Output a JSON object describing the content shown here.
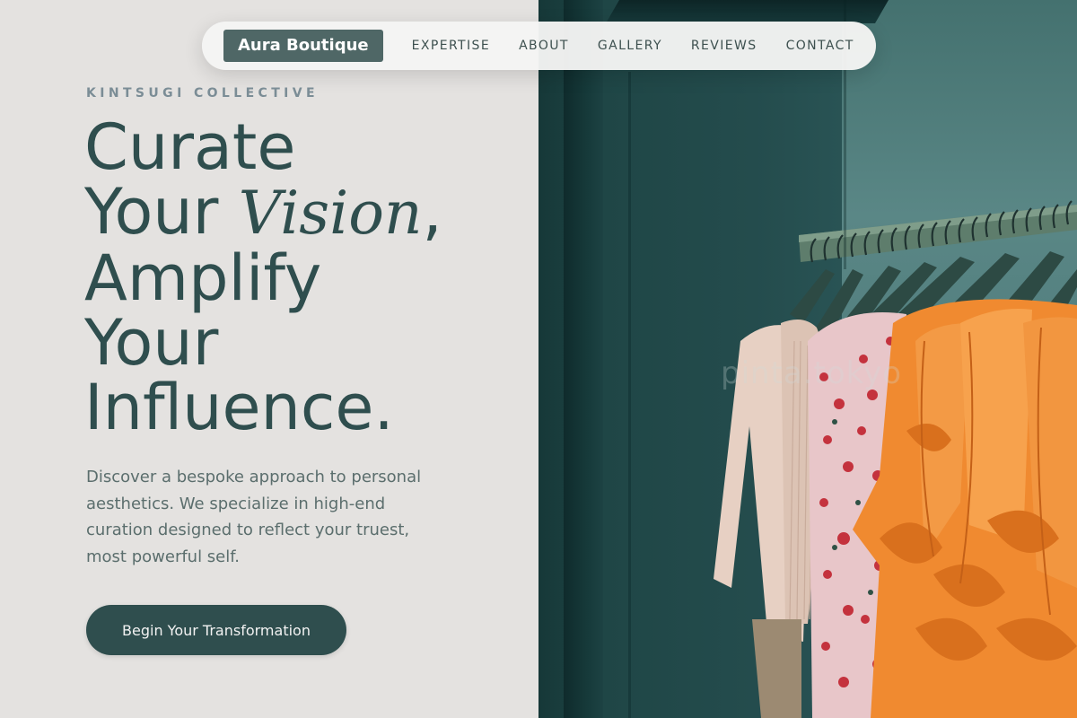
{
  "brand": {
    "logo_text": "Aura Boutique"
  },
  "nav": {
    "items": [
      {
        "label": "EXPERTISE"
      },
      {
        "label": "ABOUT"
      },
      {
        "label": "GALLERY"
      },
      {
        "label": "REVIEWS"
      },
      {
        "label": "CONTACT"
      }
    ]
  },
  "hero": {
    "eyebrow": "KINTSUGI COLLECTIVE",
    "headline": {
      "line1": "Curate",
      "line2_pre": "Your ",
      "line2_italic": "Vision",
      "line2_post": ",",
      "line3": "Amplify",
      "line4": "Your",
      "line5": "Influence."
    },
    "description": "Discover a bespoke approach to personal aesthetics. We specialize in high-end curation designed to reflect your truest, most powerful self.",
    "cta_label": "Begin Your Transformation"
  },
  "image": {
    "watermark": "pinta.tokyo",
    "subject": "clothing rack with garments"
  },
  "colors": {
    "background": "#e4e2e0",
    "primary": "#2f4e4e",
    "logo_bg": "#4f6766",
    "eyebrow": "#7b8d96",
    "body_text": "#5b6e6d"
  },
  "icons": []
}
